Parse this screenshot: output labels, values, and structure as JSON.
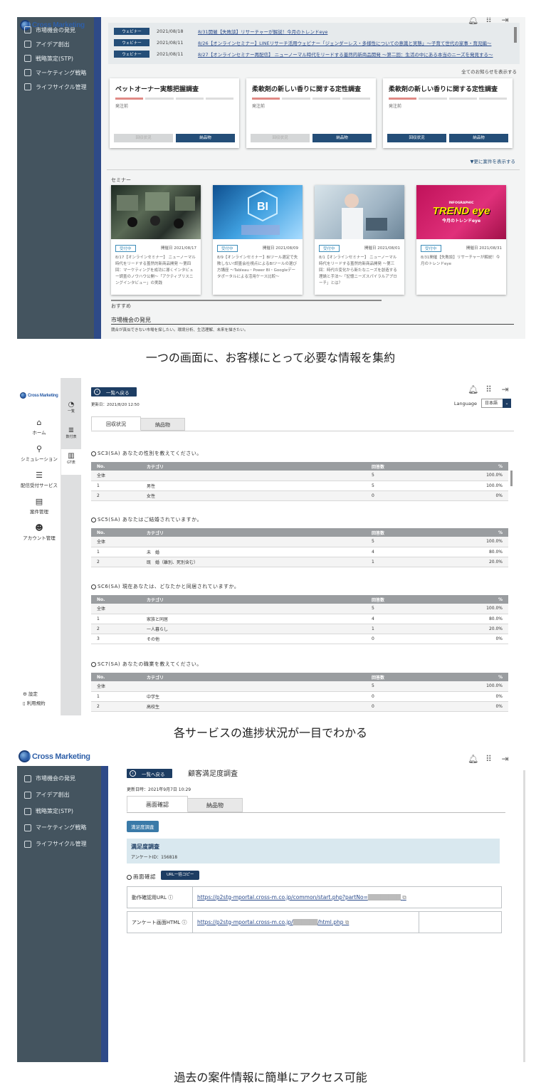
{
  "brand": "Cross Marketing",
  "sidebar_main": [
    "市場機会の発見",
    "アイデア創出",
    "戦略策定(STP)",
    "マーケティング戦略",
    "ライフサイクル管理"
  ],
  "shot1": {
    "news": [
      {
        "tag": "ウェビナー",
        "date": "2021/08/18",
        "text": "8/31開催【失敗談】リサーチャーが解説！今月のトレンドeye"
      },
      {
        "tag": "ウェビナー",
        "date": "2021/08/11",
        "text": "8/26【オンラインセミナー】LINEリサーチ活用ウェビナー「ジェンダーレス・多様性についての意識と実態」～子育て世代の家事・育児編～"
      },
      {
        "tag": "ウェビナー",
        "date": "2021/08/11",
        "text": "8/27【オンラインセミナー再配信】 ニューノーマル時代をリードする蓋然的新商品開発 ～第二回：生活の中にある本当のニーズを発見する～"
      }
    ],
    "all_news": "全てのお知らせを表示する",
    "cards": [
      {
        "title": "ペットオーナー実態把握調査",
        "status": "発注前",
        "btn1": "回収状況",
        "btn2": "納品物",
        "btn1_disabled": true
      },
      {
        "title": "柔軟剤の新しい香りに関する定性調査",
        "status": "発注前",
        "btn1": "回収状況",
        "btn2": "納品物",
        "btn1_disabled": true
      },
      {
        "title": "柔軟剤の新しい香りに関する定性調査",
        "status": "発注前",
        "btn1": "回収状況",
        "btn2": "納品物",
        "btn1_disabled": false
      }
    ],
    "more_cases": "▼更に案件を表示する",
    "seminar_label": "セミナー",
    "seminars": [
      {
        "badge": "受付中",
        "date": "開催日 2021/08/17",
        "text": "8/17【オンラインセミナー】 ニューノーマル時代をリードする蓋然的新商品開発 ～第四回：マーケティングを成功に導くインタビュー調査のノウハウ公開～「アクティブリスニングインタビュー」の実践"
      },
      {
        "badge": "受付中",
        "date": "開催日 2021/08/09",
        "text": "8/9【オンラインセミナー】BIツール選定で失敗しない!調査会社視点によるBIツールの選び方講座 ～Tableau・Power BI・Googleデータポータルによる活用ケース比較～"
      },
      {
        "badge": "受付中",
        "date": "開催日 2021/08/01",
        "text": "8/1【オンラインセミナー】 ニューノーマル時代をリードする蓋然的新商品開発 ～第三回：時代の変化から新たなニーズを創造する理論と手法～「記憶ニーズスパイラルアプローチ」とは？"
      },
      {
        "badge": "受付中",
        "date": "開催日 2021/08/31",
        "text": "8/31開催【失敗談】リサーチャーが解説！今月のトレンドeye",
        "img_title": "TREND eye",
        "img_sub": "今月のトレンドeye",
        "img_top": "INFOGRAPHIC"
      }
    ],
    "bi_text": "BI",
    "recommend": "おすすめ",
    "section": "市場機会の発見",
    "section_desc": "競合が真似できない市場を探したい。環境分析、生活理解、未来を描きたい。"
  },
  "caption1": "一つの画面に、お客様にとって必要な情報を集約",
  "shot2": {
    "back": "一覧へ戻る",
    "updated": "更新日：2021/8/20 12:50",
    "language_label": "Language",
    "language_value": "日本語",
    "tabs": [
      "回収状況",
      "納品物"
    ],
    "nav": [
      "ホーム",
      "シミュレーション",
      "配信受付サービス",
      "案件管理",
      "アカウント管理"
    ],
    "sub": [
      "一覧",
      "数付表",
      "GT表"
    ],
    "settings": "設定",
    "terms": "利用規約",
    "headers": [
      "No.",
      "カテゴリ",
      "回答数",
      "%"
    ],
    "questions": [
      {
        "title": "SC3(SA) あなたの性別を教えてください。",
        "rows": [
          [
            "全体",
            "",
            "5",
            "100.0%"
          ],
          [
            "1",
            "男性",
            "5",
            "100.0%"
          ],
          [
            "2",
            "女性",
            "0",
            "0%"
          ]
        ]
      },
      {
        "title": "SC5(SA) あなたはご結婚されていますか。",
        "rows": [
          [
            "全体",
            "",
            "5",
            "100.0%"
          ],
          [
            "1",
            "未　婚",
            "4",
            "80.0%"
          ],
          [
            "2",
            "既　婚（離別、死別含む）",
            "1",
            "20.0%"
          ]
        ]
      },
      {
        "title": "SC6(SA) 現在あなたは、どなたかと同居されていますか。",
        "rows": [
          [
            "全体",
            "",
            "5",
            "100.0%"
          ],
          [
            "1",
            "家族と同居",
            "4",
            "80.0%"
          ],
          [
            "2",
            "一人暮らし",
            "1",
            "20.0%"
          ],
          [
            "3",
            "その他",
            "0",
            "0%"
          ]
        ]
      },
      {
        "title": "SC7(SA) あなたの職業を教えてください。",
        "rows": [
          [
            "全体",
            "",
            "5",
            "100.0%"
          ],
          [
            "1",
            "中学生",
            "0",
            "0%"
          ],
          [
            "2",
            "高校生",
            "0",
            "0%"
          ]
        ]
      }
    ]
  },
  "caption2": "各サービスの進捗状況が一目でわかる",
  "shot3": {
    "back": "一覧へ戻る",
    "title": "顧客満足度調査",
    "updated": "更新日時：2021年9月7日 10:29",
    "tabs": [
      "画面確認",
      "納品物"
    ],
    "chip": "満足度調査",
    "info_title": "満足度調査",
    "info_id": "アンケートID：156818",
    "screen_check": "画面確認",
    "copy": "URL一括コピー",
    "rows": [
      {
        "label": "動作確認用URL",
        "value": "https://p2stg-mportal.cross-m.co.jp/common/start.php?partNo="
      },
      {
        "label": "アンケート画面HTML",
        "value": "https://p2stg-mportal.cross-m.co.jp/",
        "value_end": "/html.php"
      }
    ]
  },
  "caption3": "過去の案件情報に簡単にアクセス可能",
  "colors": {
    "sidebar": "#44545f",
    "stripe": "#2e4a88",
    "button": "#1d3d63",
    "accent": "#e08a86"
  }
}
